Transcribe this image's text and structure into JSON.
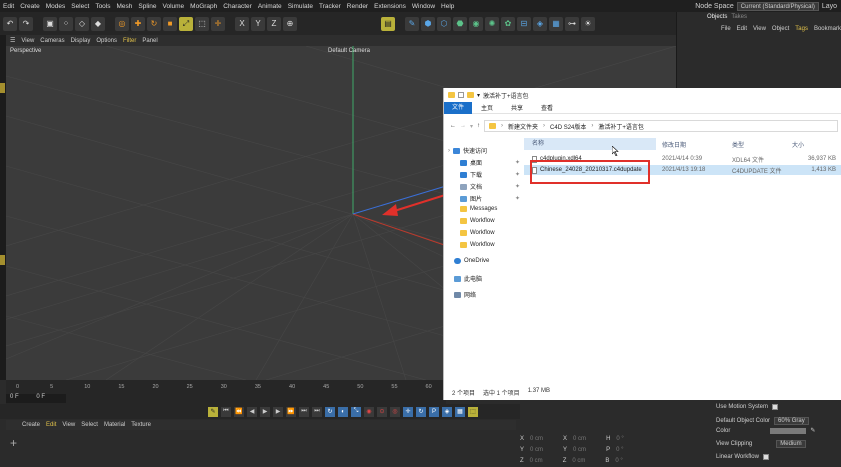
{
  "menubar": {
    "items": [
      "Edit",
      "Create",
      "Modes",
      "Select",
      "Tools",
      "Mesh",
      "Spline",
      "Volume",
      "MoGraph",
      "Character",
      "Animate",
      "Simulate",
      "Tracker",
      "Render",
      "Extensions",
      "Window",
      "Help"
    ],
    "node_space_label": "Node Space",
    "node_space_value": "Current (Standard/Physical)",
    "layout_label": "Layo"
  },
  "viewport": {
    "menu": [
      "View",
      "Cameras",
      "Display",
      "Options",
      "Filter",
      "Panel"
    ],
    "active_menu": "Filter",
    "projection_label": "Perspective",
    "camera_label": "Default Camera",
    "grid_color": "#4a4a4a",
    "axis_green": "#3fa86a",
    "axis_red": "#c0392b",
    "axis_blue": "#3a6fd8"
  },
  "object_panel": {
    "tabs": [
      "Objects",
      "Takes"
    ],
    "menu": [
      "File",
      "Edit",
      "View",
      "Object",
      "Tags",
      "Bookmark"
    ],
    "active_menu": "Tags"
  },
  "timeline": {
    "ticks": [
      "0",
      "5",
      "10",
      "15",
      "20",
      "25",
      "30",
      "35",
      "40",
      "45",
      "50",
      "55",
      "60"
    ],
    "frame_start": "0 F",
    "frame_current": "0 F"
  },
  "material_manager": {
    "menu": [
      "Create",
      "Edit",
      "View",
      "Select",
      "Material",
      "Texture"
    ],
    "active_menu": "Edit"
  },
  "coordinates": {
    "rows": [
      {
        "axis": "X",
        "a": "0 cm",
        "b": "X",
        "c": "0 cm",
        "d": "H",
        "e": "0 °"
      },
      {
        "axis": "Y",
        "a": "0 cm",
        "b": "Y",
        "c": "0 cm",
        "d": "P",
        "e": "0 °"
      },
      {
        "axis": "Z",
        "a": "0 cm",
        "b": "Z",
        "c": "0 cm",
        "d": "B",
        "e": "0 °"
      }
    ]
  },
  "attributes": {
    "use_motion_system": "Use Motion System",
    "default_object_color_label": "Default Object Color",
    "default_object_color_value": "60% Gray",
    "color_label": "Color",
    "view_clipping_label": "View Clipping",
    "view_clipping_value": "Medium",
    "linear_workflow_label": "Linear Workflow"
  },
  "explorer": {
    "title": "激活补丁+语言包",
    "ribbon_tabs": [
      "文件",
      "主页",
      "共享",
      "查看"
    ],
    "path": [
      "新建文件夹",
      "C4D S24版本",
      "激活补丁+语言包"
    ],
    "columns": {
      "name": "名称",
      "date": "修改日期",
      "type": "类型",
      "size": "大小"
    },
    "files": [
      {
        "name": "c4dplugin.xdl64",
        "date": "2021/4/14 0:39",
        "type": "XDL64 文件",
        "size": "36,937 KB",
        "selected": false
      },
      {
        "name": "Chinese_24028_20210317.c4dupdate",
        "date": "2021/4/13 19:18",
        "type": "C4DUPDATE 文件",
        "size": "1,413 KB",
        "selected": true
      }
    ],
    "nav": {
      "quick_access": "快速访问",
      "items": [
        "桌面",
        "下载",
        "文档",
        "图片",
        "Messages",
        "Workflow",
        "Workflow",
        "Workflow"
      ],
      "onedrive": "OneDrive",
      "this_pc": "此电脑",
      "network": "网络"
    },
    "status": {
      "count": "2 个项目",
      "selected": "选中 1 个项目",
      "size": "1.37 MB"
    },
    "accent": "#1a6fc9",
    "highlight": "#e0302a"
  }
}
